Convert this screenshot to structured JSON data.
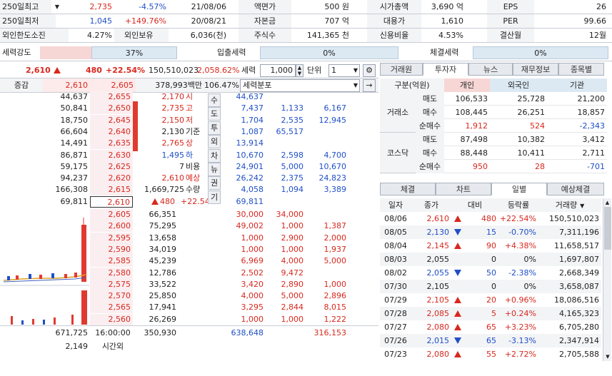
{
  "summary": {
    "rows": [
      [
        {
          "l": "250일최고",
          "v": "2,735",
          "p": "-4.57%",
          "pc": "blue",
          "d": "21/08/06"
        },
        {
          "l": "액면가",
          "v": "500 원"
        },
        {
          "l": "시가총액",
          "v": "3,690 억"
        },
        {
          "l": "EPS",
          "v": "26"
        }
      ],
      [
        {
          "l": "250일최저",
          "v": "1,045",
          "p": "+149.76%",
          "pc": "red",
          "d": "20/08/21"
        },
        {
          "l": "자본금",
          "v": "707 억"
        },
        {
          "l": "대용가",
          "v": "1,610"
        },
        {
          "l": "PER",
          "v": "99.66"
        }
      ],
      [
        {
          "l": "외인한도소진",
          "v": "4.27%",
          "p": "외인보유",
          "pc": "",
          "d": "6,036(천)"
        },
        {
          "l": "주식수",
          "v": "141,365 천"
        },
        {
          "l": "신용비율",
          "v": "4.53%"
        },
        {
          "l": "결산월",
          "v": "12월"
        }
      ]
    ]
  },
  "strength": {
    "label": "세력강도",
    "value": "37%",
    "inflow_label": "입출세력",
    "inflow_value": "0%",
    "exec_label": "체결세력",
    "exec_value": "0%"
  },
  "quote": {
    "price": "2,610",
    "change": "480",
    "rate": "+22.54%",
    "volume": "150,510,023",
    "vol_rate": "2,058.62%",
    "power_label": "세력",
    "qty": "1,000",
    "unit_label": "단위",
    "unit": "1",
    "power_dist": "세력분포"
  },
  "col_header": {
    "label": "증감",
    "c1": "2,610",
    "c2": "2,605",
    "amount": "378,993백만",
    "pct": "106.47%"
  },
  "asks": [
    {
      "q": "44,637",
      "p": "2,655",
      "w": "44,637",
      "s1": "",
      "s2": ""
    },
    {
      "q": "50,841",
      "p": "2,650",
      "w": "7,437",
      "s1": "1,133",
      "s2": "6,167"
    },
    {
      "q": "18,750",
      "p": "2,645",
      "w": "1,704",
      "s1": "2,535",
      "s2": "12,945"
    },
    {
      "q": "66,604",
      "p": "2,640",
      "w": "1,087",
      "s1": "65,517",
      "s2": ""
    },
    {
      "q": "14,491",
      "p": "2,635",
      "w": "13,914",
      "s1": "",
      "s2": ""
    },
    {
      "q": "86,871",
      "p": "2,630",
      "w": "10,670",
      "s1": "2,598",
      "s2": "4,700"
    },
    {
      "q": "59,175",
      "p": "2,625",
      "w": "24,901",
      "s1": "5,000",
      "s2": "10,670"
    },
    {
      "q": "94,237",
      "p": "2,620",
      "w": "26,242",
      "s1": "2,375",
      "s2": "24,823"
    },
    {
      "q": "166,308",
      "p": "2,615",
      "w": "4,058",
      "s1": "1,094",
      "s2": "3,389"
    },
    {
      "q": "69,811",
      "p": "2,610",
      "w": "69,811",
      "s1": "",
      "s2": ""
    }
  ],
  "info": [
    {
      "v": "2,170",
      "k": "시",
      "c": "red"
    },
    {
      "v": "2,735",
      "k": "고",
      "c": "red"
    },
    {
      "v": "2,150",
      "k": "저",
      "c": "red"
    },
    {
      "v": "2,130",
      "k": "기준",
      "c": ""
    },
    {
      "v": "2,765",
      "k": "상",
      "c": "red"
    },
    {
      "v": "1,495",
      "k": "하",
      "c": "blue"
    },
    {
      "v": "7",
      "k": "비용",
      "c": ""
    },
    {
      "v": "2,610",
      "k": "예상",
      "c": "red"
    },
    {
      "v": "1,669,725",
      "k": "수량",
      "c": ""
    },
    {
      "v": "480",
      "k": "+22.54%",
      "c": "red"
    }
  ],
  "side_buttons": [
    "수",
    "도",
    "투",
    "외",
    "차",
    "뉴",
    "권",
    "기"
  ],
  "bids": [
    {
      "p": "2,605",
      "q": "66,351",
      "w": "30,000",
      "s1": "34,000",
      "s2": ""
    },
    {
      "p": "2,600",
      "q": "75,295",
      "w": "49,002",
      "s1": "1,000",
      "s2": "1,387"
    },
    {
      "p": "2,595",
      "q": "13,658",
      "w": "1,000",
      "s1": "2,900",
      "s2": "2,000"
    },
    {
      "p": "2,590",
      "q": "34,019",
      "w": "1,000",
      "s1": "1,000",
      "s2": "1,937"
    },
    {
      "p": "2,585",
      "q": "45,239",
      "w": "6,969",
      "s1": "4,000",
      "s2": "5,000"
    },
    {
      "p": "2,580",
      "q": "12,786",
      "w": "2,502",
      "s1": "9,472",
      "s2": ""
    },
    {
      "p": "2,575",
      "q": "33,522",
      "w": "3,420",
      "s1": "2,890",
      "s2": "1,000"
    },
    {
      "p": "2,570",
      "q": "25,850",
      "w": "4,000",
      "s1": "5,000",
      "s2": "2,896"
    },
    {
      "p": "2,565",
      "q": "17,941",
      "w": "3,295",
      "s1": "2,844",
      "s2": "8,015"
    },
    {
      "p": "2,560",
      "q": "26,269",
      "w": "1,000",
      "s1": "1,000",
      "s2": "1,222"
    }
  ],
  "totals": {
    "ask_total": "671,725",
    "time": "16:00:00",
    "bid_total": "350,930",
    "w_total": "638,648",
    "s_total": "316,153",
    "after": "2,149",
    "after_label": "시간외"
  },
  "right_tabs": [
    "거래원",
    "투자자",
    "뉴스",
    "재무정보",
    "종목별"
  ],
  "investor": {
    "headers": [
      "구분(억원)",
      "개인",
      "외국인",
      "기관"
    ],
    "groups": [
      {
        "name": "거래소",
        "rows": [
          {
            "k": "매도",
            "a": "106,533",
            "b": "25,728",
            "c": "21,200",
            "ca": "",
            "cb": "",
            "cc": ""
          },
          {
            "k": "매수",
            "a": "108,445",
            "b": "26,251",
            "c": "18,857",
            "ca": "",
            "cb": "",
            "cc": ""
          },
          {
            "k": "순매수",
            "a": "1,912",
            "b": "524",
            "c": "-2,343",
            "ca": "red",
            "cb": "red",
            "cc": "blue"
          }
        ]
      },
      {
        "name": "코스닥",
        "rows": [
          {
            "k": "매도",
            "a": "87,498",
            "b": "10,382",
            "c": "3,412",
            "ca": "",
            "cb": "",
            "cc": ""
          },
          {
            "k": "매수",
            "a": "88,448",
            "b": "10,411",
            "c": "2,711",
            "ca": "",
            "cb": "",
            "cc": ""
          },
          {
            "k": "순매수",
            "a": "950",
            "b": "28",
            "c": "-701",
            "ca": "red",
            "cb": "red",
            "cc": "blue"
          }
        ]
      }
    ]
  },
  "daily_tabs": [
    "체결",
    "차트",
    "일별",
    "예상체결"
  ],
  "daily": {
    "headers": [
      "일자",
      "종가",
      "대비",
      "등락률",
      "거래량"
    ],
    "rows": [
      {
        "d": "08/06",
        "c": "2,610",
        "dir": "up",
        "ch": "480",
        "r": "+22.54%",
        "v": "150,510,023",
        "col": "red"
      },
      {
        "d": "08/05",
        "c": "2,130",
        "dir": "dn",
        "ch": "15",
        "r": "-0.70%",
        "v": "7,311,196",
        "col": "blue"
      },
      {
        "d": "08/04",
        "c": "2,145",
        "dir": "up",
        "ch": "90",
        "r": "+4.38%",
        "v": "11,658,517",
        "col": "red"
      },
      {
        "d": "08/03",
        "c": "2,055",
        "dir": "",
        "ch": "0",
        "r": "0%",
        "v": "1,697,807",
        "col": ""
      },
      {
        "d": "08/02",
        "c": "2,055",
        "dir": "dn",
        "ch": "50",
        "r": "-2.38%",
        "v": "2,668,349",
        "col": "blue"
      },
      {
        "d": "07/30",
        "c": "2,105",
        "dir": "",
        "ch": "0",
        "r": "0%",
        "v": "3,658,087",
        "col": ""
      },
      {
        "d": "07/29",
        "c": "2,105",
        "dir": "up",
        "ch": "20",
        "r": "+0.96%",
        "v": "18,086,516",
        "col": "red"
      },
      {
        "d": "07/28",
        "c": "2,085",
        "dir": "up",
        "ch": "5",
        "r": "+0.24%",
        "v": "4,165,323",
        "col": "red"
      },
      {
        "d": "07/27",
        "c": "2,080",
        "dir": "up",
        "ch": "65",
        "r": "+3.23%",
        "v": "6,705,280",
        "col": "red"
      },
      {
        "d": "07/26",
        "c": "2,015",
        "dir": "dn",
        "ch": "65",
        "r": "-3.13%",
        "v": "2,347,914",
        "col": "blue"
      },
      {
        "d": "07/23",
        "c": "2,080",
        "dir": "up",
        "ch": "55",
        "r": "+2.72%",
        "v": "2,705,588",
        "col": "red"
      }
    ]
  },
  "colors": {
    "up": "#d8281e",
    "down": "#1f4fc7",
    "ask_bg": "#eef3fb",
    "bid_bg": "#fbeef0",
    "accent": "#f2c9c9"
  }
}
